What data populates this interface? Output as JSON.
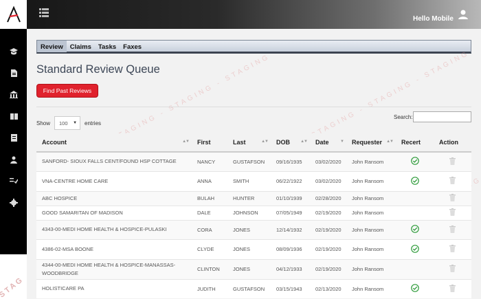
{
  "app": {
    "logo_letter": "A",
    "greeting": "Hello Mobile",
    "brand_color": "#e0222d",
    "watermark": "STAGING - STAGING - STAGING"
  },
  "sidebar": {
    "items": [
      {
        "icon": "graduation-cap-icon"
      },
      {
        "icon": "document-icon"
      },
      {
        "icon": "building-icon"
      },
      {
        "icon": "book-icon"
      },
      {
        "icon": "file-icon"
      },
      {
        "icon": "person-icon"
      },
      {
        "icon": "list-check-icon"
      },
      {
        "icon": "gear-icon"
      }
    ],
    "stamp": "STAG"
  },
  "tabs": [
    {
      "label": "Review",
      "active": true
    },
    {
      "label": "Claims"
    },
    {
      "label": "Tasks"
    },
    {
      "label": "Faxes"
    }
  ],
  "page_title": "Standard Review Queue",
  "find_button": "Find Past Reviews",
  "length": {
    "show": "Show",
    "value": "100",
    "entries": "entries"
  },
  "search": {
    "label": "Search:",
    "value": ""
  },
  "table": {
    "columns": [
      "Account",
      "First",
      "Last",
      "DOB",
      "Date",
      "Requester",
      "Recert",
      "Action"
    ],
    "rows": [
      {
        "account": "SANFORD- SIOUX FALLS CENT/FOUND HSP COTTAGE",
        "first": "NANCY",
        "last": "GUSTAFSON",
        "dob": "09/16/1935",
        "date": "03/02/2020",
        "requester": "John Ransom",
        "recert": true
      },
      {
        "account": "VNA-CENTRE HOME CARE",
        "first": "ANNA",
        "last": "SMITH",
        "dob": "06/22/1922",
        "date": "03/02/2020",
        "requester": "John Ransom",
        "recert": true
      },
      {
        "account": "ABC HOSPICE",
        "first": "BULAH",
        "last": "HUNTER",
        "dob": "01/10/1939",
        "date": "02/28/2020",
        "requester": "John Ransom",
        "recert": false
      },
      {
        "account": "GOOD SAMARITAN OF MADISON",
        "first": "DALE",
        "last": "JOHNSON",
        "dob": "07/05/1949",
        "date": "02/19/2020",
        "requester": "John Ransom",
        "recert": false
      },
      {
        "account": "4343-00-MEDI HOME HEALTH & HOSPICE-PULASKI",
        "first": "CORA",
        "last": "JONES",
        "dob": "12/14/1932",
        "date": "02/19/2020",
        "requester": "John Ransom",
        "recert": true
      },
      {
        "account": "4386-02-MSA BOONE",
        "first": "CLYDE",
        "last": "JONES",
        "dob": "08/09/1936",
        "date": "02/19/2020",
        "requester": "John Ransom",
        "recert": true
      },
      {
        "account": "4344-00-MEDI HOME HEALTH & HOSPICE-MANASSAS-WOODBRIDGE",
        "first": "CLINTON",
        "last": "JONES",
        "dob": "04/12/1933",
        "date": "02/19/2020",
        "requester": "John Ransom",
        "recert": false
      },
      {
        "account": "HOLISTICARE PA",
        "first": "JUDITH",
        "last": "GUSTAFSON",
        "dob": "03/15/1943",
        "date": "02/13/2020",
        "requester": "John Ransom",
        "recert": true
      }
    ]
  }
}
